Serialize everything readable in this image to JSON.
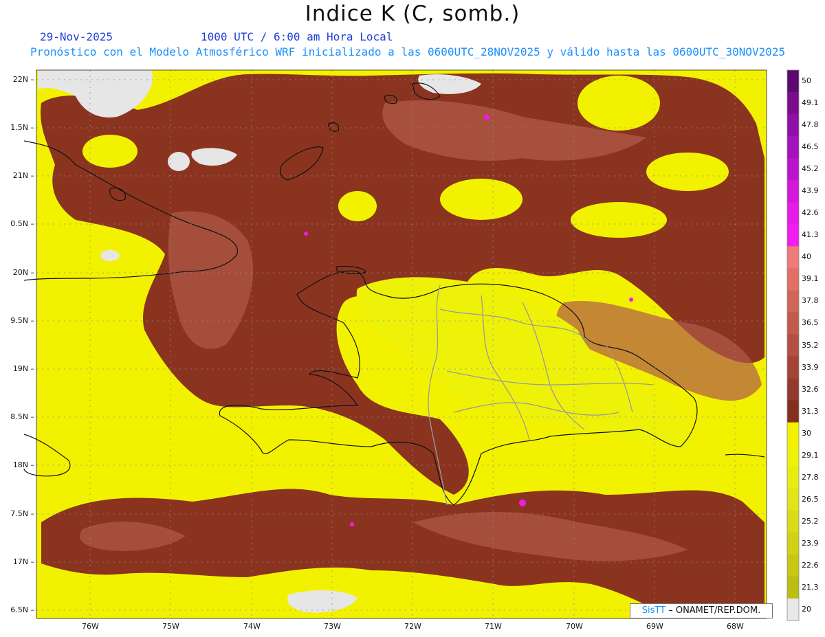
{
  "header": {
    "title": "Indice K (C, somb.)",
    "date": "29-Nov-2025",
    "valid_time": "1000 UTC / 6:00 am Hora Local",
    "description": "Pronóstico con el Modelo Atmosférico WRF inicializado a las 0600UTC_28NOV2025 y válido hasta las  0600UTC_30NOV2025"
  },
  "map": {
    "lat_labels": [
      "22N",
      "1.5N",
      "21N",
      "0.5N",
      "20N",
      "9.5N",
      "19N",
      "8.5N",
      "18N",
      "7.5N",
      "17N",
      "6.5N"
    ],
    "lon_labels": [
      "76W",
      "75W",
      "74W",
      "73W",
      "72W",
      "71W",
      "70W",
      "69W",
      "68W"
    ],
    "credit_brand": "SisTT",
    "credit_text": "– ONAMET/REP.DOM."
  },
  "colorbar": {
    "labels": [
      "50",
      "49.1",
      "47.8",
      "46.5",
      "45.2",
      "43.9",
      "42.6",
      "41.3",
      "40",
      "39.1",
      "37.8",
      "36.5",
      "35.2",
      "33.9",
      "32.6",
      "31.3",
      "30",
      "29.1",
      "27.8",
      "26.5",
      "25.2",
      "23.9",
      "22.6",
      "21.3",
      "20"
    ],
    "colors": [
      "#5a0a6e",
      "#7a0d8c",
      "#8e10a6",
      "#a312bc",
      "#bb14cc",
      "#d318d8",
      "#e61ce6",
      "#f01ef0",
      "#f07a7a",
      "#e07066",
      "#d0655a",
      "#c25a4e",
      "#b44f43",
      "#a44438",
      "#94392e",
      "#84301f",
      "#f2f200",
      "#eef208",
      "#e8ec10",
      "#e0e418",
      "#d8dc18",
      "#cfd216",
      "#c6c814",
      "#bcbd12",
      "#e8e8e8"
    ],
    "palette": {
      "yellow": "#f2f200",
      "yellow_light": "#e8ec3a",
      "brown": "#8a3420",
      "brown_light": "#b05a48",
      "magenta": "#ee1aee",
      "gray": "#e6e6e6"
    }
  }
}
